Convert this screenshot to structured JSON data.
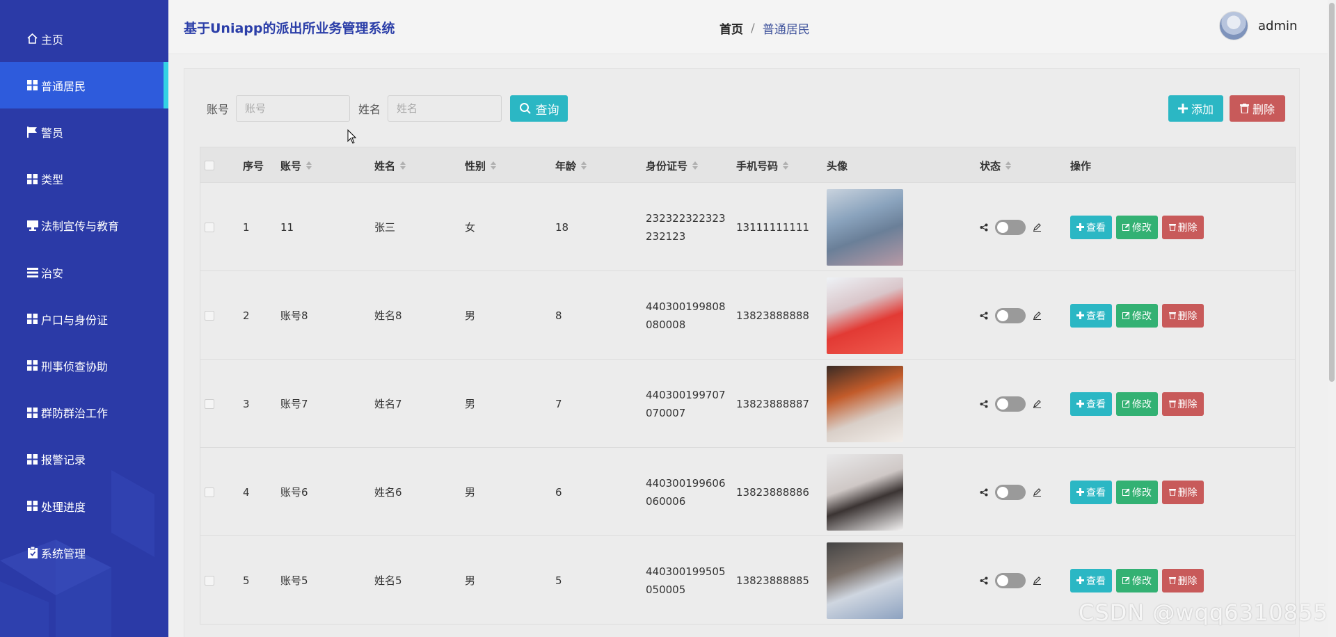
{
  "sidebar": {
    "items": [
      {
        "label": "主页",
        "icon": "home-icon"
      },
      {
        "label": "普通居民",
        "icon": "grid-icon",
        "active": true
      },
      {
        "label": "警员",
        "icon": "flag-icon"
      },
      {
        "label": "类型",
        "icon": "grid-icon"
      },
      {
        "label": "法制宣传与教育",
        "icon": "monitor-icon"
      },
      {
        "label": "治安",
        "icon": "list-icon"
      },
      {
        "label": "户口与身份证",
        "icon": "grid-icon"
      },
      {
        "label": "刑事侦查协助",
        "icon": "grid-icon"
      },
      {
        "label": "群防群治工作",
        "icon": "grid-icon"
      },
      {
        "label": "报警记录",
        "icon": "grid-icon"
      },
      {
        "label": "处理进度",
        "icon": "grid-icon"
      },
      {
        "label": "系统管理",
        "icon": "clipboard-icon"
      }
    ]
  },
  "header": {
    "title": "基于Uniapp的派出所业务管理系统",
    "breadcrumb_home": "首页",
    "breadcrumb_sep": "/",
    "breadcrumb_current": "普通居民",
    "username": "admin"
  },
  "search": {
    "account_label": "账号",
    "account_placeholder": "账号",
    "name_label": "姓名",
    "name_placeholder": "姓名",
    "query_label": "查询",
    "add_label": "添加",
    "delete_label": "删除"
  },
  "table": {
    "headers": {
      "index": "序号",
      "account": "账号",
      "name": "姓名",
      "gender": "性别",
      "age": "年龄",
      "id_card": "身份证号",
      "phone": "手机号码",
      "avatar": "头像",
      "status": "状态",
      "actions": "操作"
    },
    "view_label": "查看",
    "edit_label": "修改",
    "delete_label": "删除",
    "rows": [
      {
        "index": "1",
        "account": "11",
        "name": "张三",
        "gender": "女",
        "age": "18",
        "id_card": "232322322323232123",
        "phone": "13111111111"
      },
      {
        "index": "2",
        "account": "账号8",
        "name": "姓名8",
        "gender": "男",
        "age": "8",
        "id_card": "440300199808080008",
        "phone": "13823888888"
      },
      {
        "index": "3",
        "account": "账号7",
        "name": "姓名7",
        "gender": "男",
        "age": "7",
        "id_card": "440300199707070007",
        "phone": "13823888887"
      },
      {
        "index": "4",
        "account": "账号6",
        "name": "姓名6",
        "gender": "男",
        "age": "6",
        "id_card": "440300199606060006",
        "phone": "13823888886"
      },
      {
        "index": "5",
        "account": "账号5",
        "name": "姓名5",
        "gender": "男",
        "age": "5",
        "id_card": "440300199505050005",
        "phone": "13823888885"
      }
    ]
  },
  "watermark": "CSDN @wqq6310855",
  "colors": {
    "sidebar_bg": "#2b3aa7",
    "sidebar_active": "#2e5bdc",
    "accent_cyan": "#2bb7c4",
    "edit_green": "#33b173",
    "delete_red": "#c85a5a",
    "title_blue": "#2b3ea8"
  }
}
